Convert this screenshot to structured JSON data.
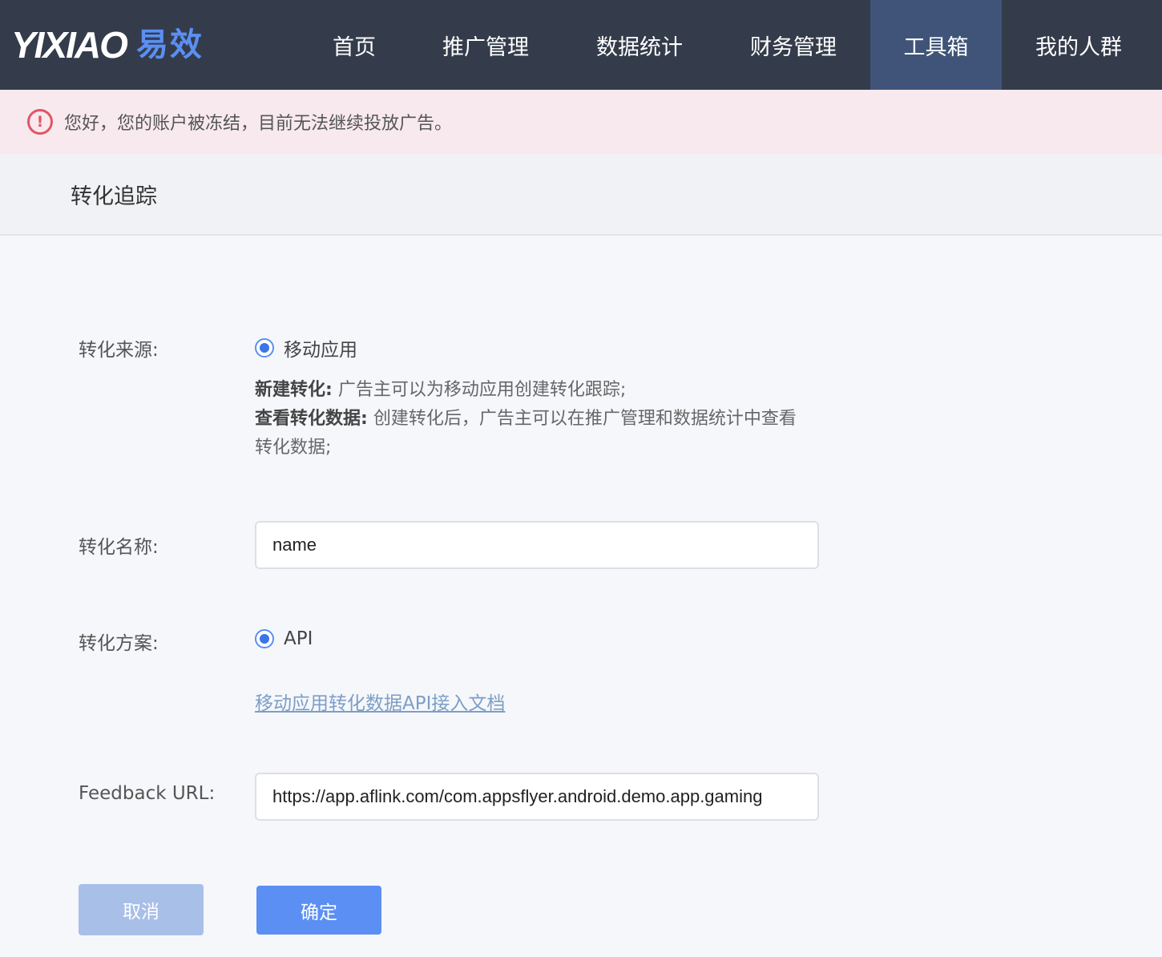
{
  "logo": {
    "latin": "YIXIAO",
    "cn": "易效"
  },
  "nav": {
    "items": [
      {
        "label": "首页"
      },
      {
        "label": "推广管理"
      },
      {
        "label": "数据统计"
      },
      {
        "label": "财务管理"
      },
      {
        "label": "工具箱"
      },
      {
        "label": "我的人群"
      }
    ],
    "active": "工具箱"
  },
  "alert": {
    "icon": "exclamation-icon",
    "text": "您好，您的账户被冻结，目前无法继续投放广告。"
  },
  "page": {
    "title": "转化追踪"
  },
  "form": {
    "source": {
      "label": "转化来源:",
      "option": "移动应用",
      "desc1_bold": "新建转化:",
      "desc1_text": "广告主可以为移动应用创建转化跟踪;",
      "desc2_bold": "查看转化数据:",
      "desc2_text": "创建转化后，广告主可以在推广管理和数据统计中查看转化数据;"
    },
    "name": {
      "label": "转化名称:",
      "value": "name"
    },
    "plan": {
      "label": "转化方案:",
      "option": "API",
      "doc_link": "移动应用转化数据API接入文档"
    },
    "feedback": {
      "label": "Feedback URL:",
      "value": "https://app.aflink.com/com.appsflyer.android.demo.app.gaming"
    },
    "buttons": {
      "cancel": "取消",
      "ok": "确定"
    }
  },
  "colors": {
    "nav_bg": "#343c4b",
    "nav_active": "#3f5478",
    "accent": "#5b8ff4",
    "alert_bg": "#f7e9ee",
    "alert_icon": "#e05566"
  }
}
